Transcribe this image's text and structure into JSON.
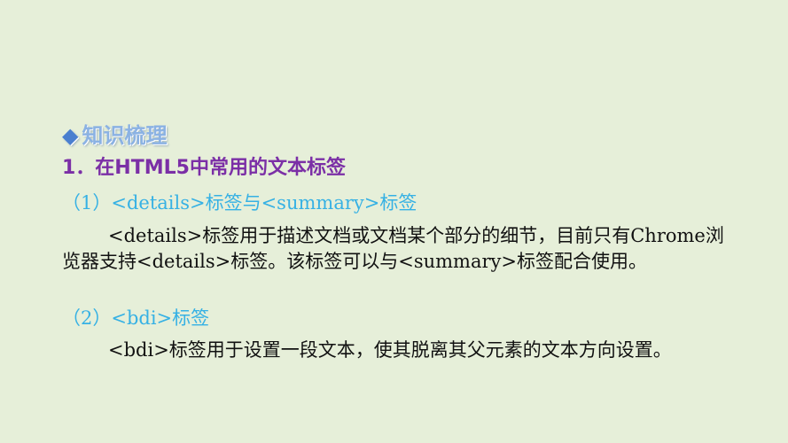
{
  "slide": {
    "section_bullet": "◆",
    "section_heading": "知识梳理",
    "title": "1．在HTML5中常用的文本标签",
    "items": [
      {
        "subhead": "（1）<details>标签与<summary>标签",
        "paragraph": "<details>标签用于描述文档或文档某个部分的细节，目前只有Chrome浏览器支持<details>标签。该标签可以与<summary>标签配合使用。"
      },
      {
        "subhead": "（2）<bdi>标签",
        "paragraph": "<bdi>标签用于设置一段文本，使其脱离其父元素的文本方向设置。"
      }
    ]
  },
  "colors": {
    "background": "#e6efd9",
    "section_heading": "#8bb2e3",
    "title": "#7b2fa6",
    "subhead": "#36b1e4",
    "body_text": "#111111"
  }
}
